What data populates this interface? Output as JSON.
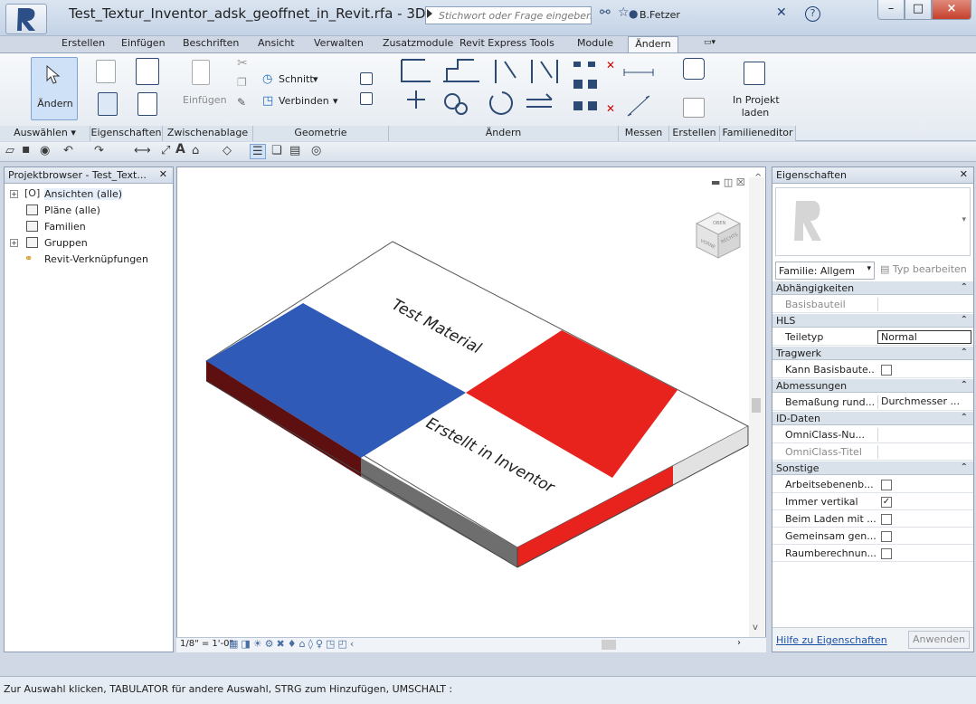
{
  "window": {
    "title": "Test_Textur_Inventor_adsk_geoffnet_in_Revit.rfa - 3D-A...",
    "search_placeholder": "Stichwort oder Frage eingeben",
    "user": "B.Fetzer"
  },
  "ribbon_tabs": [
    "Erstellen",
    "Einfügen",
    "Beschriften",
    "Ansicht",
    "Verwalten",
    "Zusatzmodule",
    "Revit Express Tools",
    "Module",
    "Ändern"
  ],
  "ribbon": {
    "modify_label": "Ändern",
    "paste_label": "Einfügen",
    "cut_label": "Schnitt",
    "join_label": "Verbinden",
    "load_project_label_1": "In Projekt",
    "load_project_label_2": "laden",
    "panels": [
      "Auswählen ▾",
      "Eigenschaften",
      "Zwischenablage",
      "Geometrie",
      "Ändern",
      "Messen",
      "Erstellen",
      "Familieneditor"
    ]
  },
  "project_browser": {
    "title": "Projektbrowser - Test_Text...",
    "items": [
      "Ansichten (alle)",
      "Pläne (alle)",
      "Familien",
      "Gruppen",
      "Revit-Verknüpfungen"
    ]
  },
  "viewport": {
    "model_text_top": "Test Material",
    "model_text_bottom": "Erstellt in Inventor",
    "scale": "1/8\" = 1'-0\"",
    "viewcube_labels": [
      "OBEN",
      "VORNE",
      "RECHTS"
    ],
    "colors": {
      "blue": "#2f5ab7",
      "red": "#e8231d",
      "dark_red": "#5e0f0f",
      "gray": "#6e6e6e",
      "light_gray": "#e2e2e2"
    }
  },
  "properties": {
    "title": "Eigenschaften",
    "family_select": "Familie: Allgem",
    "edit_type": "Typ bearbeiten",
    "groups": [
      {
        "name": "Abhängigkeiten",
        "rows": [
          {
            "name": "Basisbauteil",
            "value": "",
            "type": "text",
            "disabled": true
          }
        ]
      },
      {
        "name": "HLS",
        "rows": [
          {
            "name": "Teiletyp",
            "value": "Normal",
            "type": "input"
          }
        ]
      },
      {
        "name": "Tragwerk",
        "rows": [
          {
            "name": "Kann Basisbaute...",
            "checked": false,
            "type": "check"
          }
        ]
      },
      {
        "name": "Abmessungen",
        "rows": [
          {
            "name": "Bemaßung rund...",
            "value": "Durchmesser ...",
            "type": "text"
          }
        ]
      },
      {
        "name": "ID-Daten",
        "rows": [
          {
            "name": "OmniClass-Nu...",
            "value": "",
            "type": "text"
          },
          {
            "name": "OmniClass-Titel",
            "value": "",
            "type": "text",
            "disabled": true
          }
        ]
      },
      {
        "name": "Sonstige",
        "rows": [
          {
            "name": "Arbeitsebenenb...",
            "checked": false,
            "type": "check"
          },
          {
            "name": "Immer vertikal",
            "checked": true,
            "type": "check"
          },
          {
            "name": "Beim Laden mit ...",
            "checked": false,
            "type": "check"
          },
          {
            "name": "Gemeinsam gen...",
            "checked": false,
            "type": "check"
          },
          {
            "name": "Raumberechnun...",
            "checked": false,
            "type": "check"
          }
        ]
      }
    ],
    "help_link": "Hilfe zu Eigenschaften",
    "apply_button": "Anwenden"
  },
  "status_bar": "Zur Auswahl klicken, TABULATOR für andere Auswahl, STRG zum Hinzufügen, UMSCHALT :"
}
